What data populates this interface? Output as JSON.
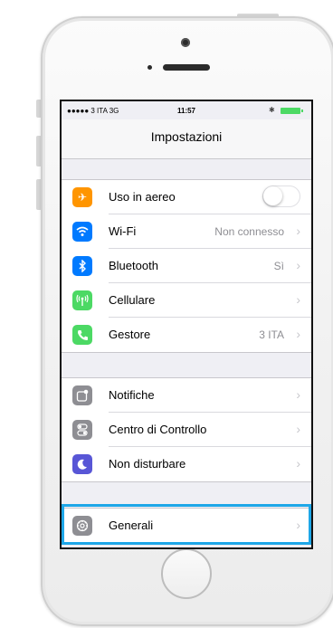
{
  "status_bar": {
    "carrier": "●●●●● 3 ITA  3G",
    "time": "11:57",
    "bluetooth_icon": "bluetooth-icon",
    "battery_icon": "battery-icon"
  },
  "nav": {
    "title": "Impostazioni"
  },
  "groups": [
    {
      "items": [
        {
          "label": "Uso in aereo",
          "icon": "airplane-icon",
          "icon_color": "#ff9500",
          "control": "toggle",
          "toggle_on": false
        },
        {
          "label": "Wi-Fi",
          "icon": "wifi-icon",
          "icon_color": "#007aff",
          "value": "Non connesso"
        },
        {
          "label": "Bluetooth",
          "icon": "bluetooth-icon",
          "icon_color": "#007aff",
          "value": "Sì"
        },
        {
          "label": "Cellulare",
          "icon": "cellular-icon",
          "icon_color": "#4cd964",
          "value": ""
        },
        {
          "label": "Gestore",
          "icon": "phone-icon",
          "icon_color": "#4cd964",
          "value": "3 ITA"
        }
      ]
    },
    {
      "items": [
        {
          "label": "Notifiche",
          "icon": "notifications-icon",
          "icon_color": "#8e8e93"
        },
        {
          "label": "Centro di Controllo",
          "icon": "control-center-icon",
          "icon_color": "#8e8e93"
        },
        {
          "label": "Non disturbare",
          "icon": "moon-icon",
          "icon_color": "#5856d6"
        }
      ]
    },
    {
      "items": [
        {
          "label": "Generali",
          "icon": "gear-icon",
          "icon_color": "#8e8e93",
          "highlighted": true,
          "highlight_color": "#1ea7e8"
        }
      ]
    }
  ]
}
